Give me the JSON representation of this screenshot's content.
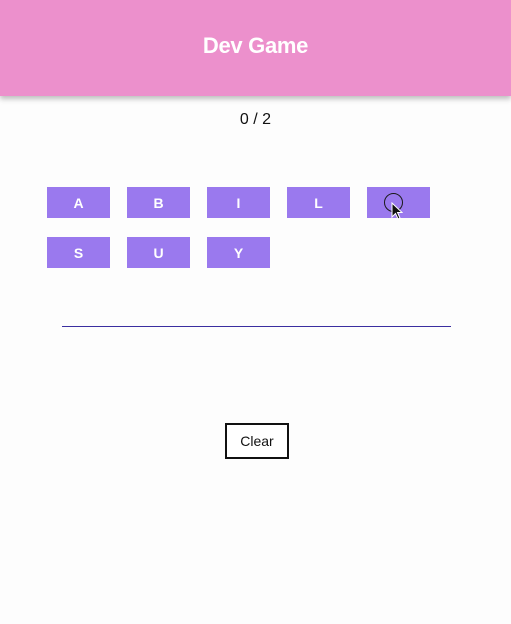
{
  "header": {
    "title": "Dev Game"
  },
  "score": {
    "text": "0 / 2"
  },
  "tiles": [
    {
      "letter": "A"
    },
    {
      "letter": "B"
    },
    {
      "letter": "I"
    },
    {
      "letter": "L"
    },
    {
      "letter": ""
    },
    {
      "letter": "S"
    },
    {
      "letter": "U"
    },
    {
      "letter": "Y"
    }
  ],
  "controls": {
    "clear_label": "Clear"
  },
  "colors": {
    "header_bg": "#ec90cc",
    "tile_bg": "#9a79ee",
    "line": "#3b2fa0"
  },
  "icons": {
    "pointer": "mouse-pointer-icon"
  }
}
